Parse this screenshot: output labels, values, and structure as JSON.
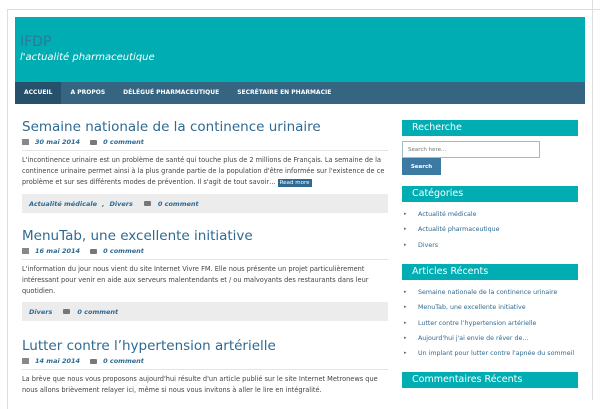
{
  "site": {
    "title": "IFDP",
    "tagline": "l'actualité pharmaceutique"
  },
  "nav": [
    "ACCUEIL",
    "A PROPOS",
    "DÉLÉGUÉ PHARMACEUTIQUE",
    "SECRÉTAIRE EN PHARMACIE"
  ],
  "posts": [
    {
      "title": "Semaine nationale de la continence urinaire",
      "date": "30 mai 2014",
      "comments": "0 comment",
      "excerpt": "L'incontinence urinaire est un problème de santé qui touche plus de 2 millions de Français. La semaine de la continence urinaire permet ainsi à la plus grande partie de la population d'être informée sur l'existence de ce problème et sur ses différents modes de prévention. Il s'agit de tout savoir…",
      "read_more": "Read more",
      "categories": [
        "Actualité médicale",
        "Divers"
      ],
      "sep": ","
    },
    {
      "title": "MenuTab, une excellente initiative",
      "date": "16 mai 2014",
      "comments": "0 comment",
      "excerpt": "L'information du jour nous vient du site Internet Vivre FM. Elle nous présente un projet particulièrement intéressant pour venir en aide aux serveurs malentendants et / ou malvoyants des restaurants dans leur quotidien.",
      "categories": [
        "Divers"
      ]
    },
    {
      "title": "Lutter contre l’hypertension artérielle",
      "date": "14 mai 2014",
      "comments": "0 comment",
      "excerpt": "La brève que nous vous proposons aujourd'hui résulte d'un article publié sur le site Internet Metronews que nous allons brièvement relayer ici, même si nous vous invitons à aller le lire en intégralité."
    }
  ],
  "sidebar": {
    "search_title": "Recherche",
    "search_placeholder": "Search here...",
    "search_button": "Search",
    "categories_title": "Catégories",
    "categories": [
      "Actualité médicale",
      "Actualité pharmaceutique",
      "Divers"
    ],
    "recent_title": "Articles Récents",
    "recent": [
      "Semaine nationale de la continence urinaire",
      "MenuTab, une excellente initiative",
      "Lutter contre l’hypertension artérielle",
      "Aujourd'hui j'ai envie de rêver de…",
      "Un implant pour lutter contre l'apnée du sommeil"
    ],
    "comments_title": "Commentaires Récents"
  }
}
